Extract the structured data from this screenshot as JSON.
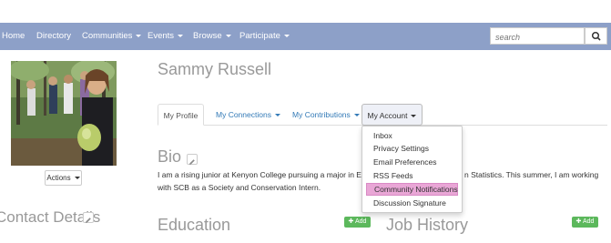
{
  "nav": {
    "items": [
      {
        "label": "Home",
        "has_caret": false
      },
      {
        "label": "Directory",
        "has_caret": false
      },
      {
        "label": "Communities",
        "has_caret": true
      },
      {
        "label": "Events",
        "has_caret": true
      },
      {
        "label": "Browse",
        "has_caret": true
      },
      {
        "label": "Participate",
        "has_caret": true
      }
    ],
    "search_placeholder": "search",
    "bar_color": "#8da0c8"
  },
  "profile": {
    "name": "Sammy Russell",
    "actions_label": "Actions"
  },
  "tabs": [
    {
      "label": "My Profile",
      "state": "active"
    },
    {
      "label": "My Connections",
      "state": "normal"
    },
    {
      "label": "My Contributions",
      "state": "normal"
    },
    {
      "label": "My Account",
      "state": "open"
    }
  ],
  "account_menu": [
    {
      "label": "Inbox",
      "highlighted": false
    },
    {
      "label": "Privacy Settings",
      "highlighted": false
    },
    {
      "label": "Email Preferences",
      "highlighted": false
    },
    {
      "label": "RSS Feeds",
      "highlighted": false
    },
    {
      "label": "Community Notifications",
      "highlighted": true
    },
    {
      "label": "Discussion Signature",
      "highlighted": false
    }
  ],
  "bio": {
    "heading": "Bio",
    "line1_start": "I am a rising junior at Kenyon College pursuing a major in Envi",
    "line1_end": "n Statistics. This summer, I am working",
    "line2": "with SCB as a Society and Conservation Intern."
  },
  "sections": {
    "contact_heading": "Contact Details",
    "education_heading": "Education",
    "job_heading": "Job History",
    "add_label": "Add"
  },
  "colors": {
    "link": "#337ab7",
    "add_green": "#5cb85c",
    "highlight": "#e9a6d6"
  }
}
